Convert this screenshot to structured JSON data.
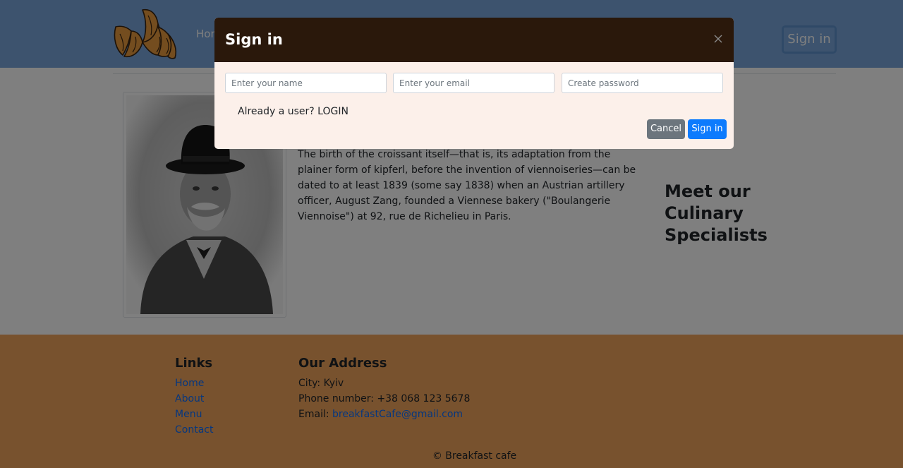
{
  "nav": {
    "home_label": "Home",
    "signin_label": "Sign in"
  },
  "colors": {
    "navbar": "#7aa7dc",
    "footer": "#f1a45d",
    "modal_header": "#2a180b",
    "modal_body": "#fcf0ea",
    "primary_button": "#0d7bfd",
    "secondary_button": "#6c757d",
    "link": "#0d6efd"
  },
  "main": {
    "story": "The birth of the croissant itself—that is, its adaptation from the plainer form of kipferl, before the invention of viennoiseries—can be dated to at least 1839 (some say 1838) when an Austrian artillery officer, August Zang, founded a Viennese bakery (\"Boulangerie Viennoise\") at 92, rue de Richelieu in Paris.",
    "specialists_title": "Meet our Culinary Specialists"
  },
  "footer": {
    "links_title": "Links",
    "links": [
      "Home",
      "About",
      "Menu",
      "Contact"
    ],
    "address_title": "Our Address",
    "city": "City: Kyiv",
    "phone": "Phone number: +38 068 123 5678",
    "email_label": "Email: ",
    "email": "breakfastCafe@gmail.com",
    "copyright": "© Breakfast cafe"
  },
  "modal": {
    "title": "Sign in",
    "name_placeholder": "Enter your name",
    "email_placeholder": "Enter your email",
    "password_placeholder": "Create password",
    "already_user": "Already a user? LOGIN",
    "cancel_label": "Cancel",
    "signin_label": "Sign in"
  }
}
